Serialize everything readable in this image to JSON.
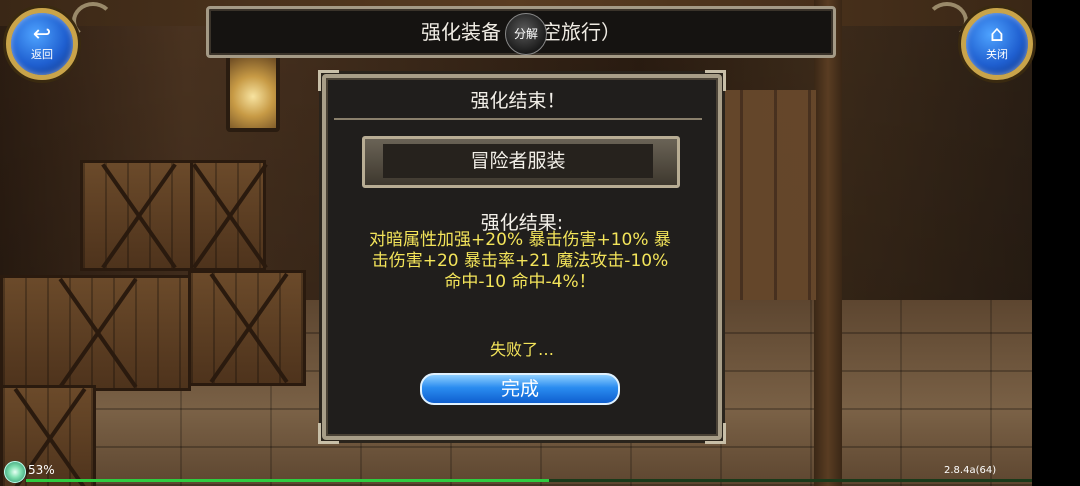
{
  "header": {
    "title": "强化装备（时空旅行）",
    "badge": "分解"
  },
  "buttons": {
    "back": {
      "icon": "back-arrow-icon",
      "label": "返回"
    },
    "close": {
      "icon": "home-icon",
      "label": "关闭"
    }
  },
  "dialog": {
    "title": "强化结束！",
    "item_name": "冒险者服装",
    "result_label": "强化结果:",
    "result_lines": [
      "对暗属性加强+20% 暴击伤害+10% 暴",
      "击伤害+20 暴击率+21 魔法攻击-10%",
      "命中-10 命中-4%！"
    ],
    "status": "失败了…",
    "done_label": "完成"
  },
  "status_bar": {
    "battery_percent": "53%",
    "version": "2.8.4a(64)",
    "progress": 0.52
  },
  "colors": {
    "accent_yellow": "#f3e45a",
    "button_blue": "#2a8cf0",
    "frame_gold": "#c9a44a",
    "progress_green": "#2ecc40"
  }
}
